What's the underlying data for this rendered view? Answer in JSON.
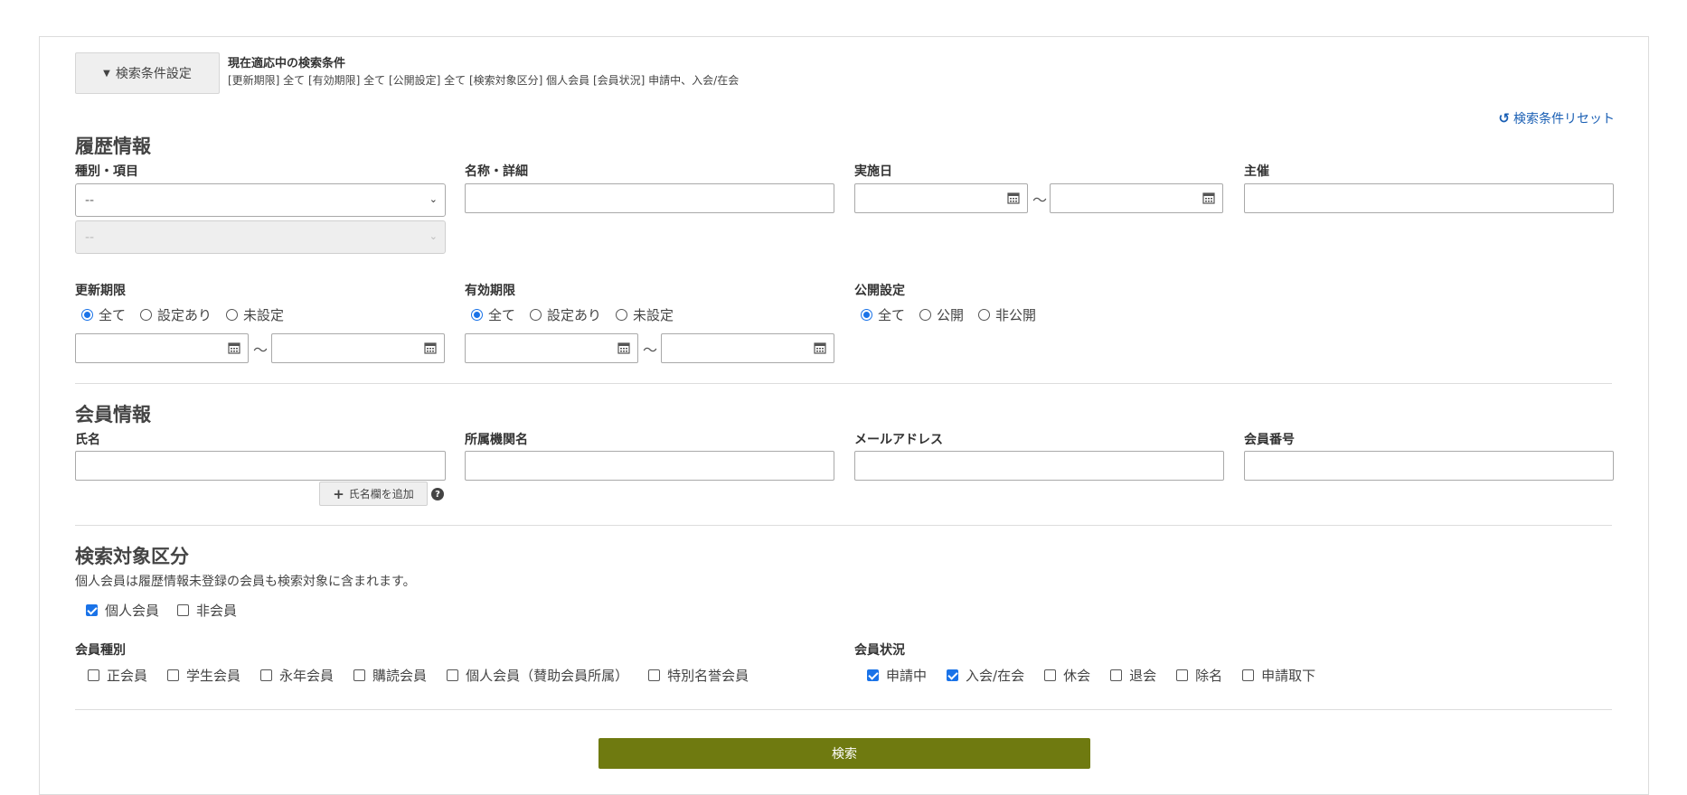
{
  "top": {
    "toggle_label": "検索条件設定",
    "current_title": "現在適応中の検索条件",
    "current_summary": "[更新期限] 全て [有効期限] 全て [公開設定] 全て [検索対象区分] 個人会員 [会員状況] 申請中、入会/在会",
    "reset_label": "検索条件リセット"
  },
  "history": {
    "title": "履歴情報",
    "type_label": "種別・項目",
    "type_select_value": "--",
    "type_sub_select_value": "--",
    "name_label": "名称・詳細",
    "date_label": "実施日",
    "date_sep": "～",
    "host_label": "主催",
    "update_label": "更新期限",
    "valid_label": "有効期限",
    "publish_label": "公開設定",
    "update_options": [
      "全て",
      "設定あり",
      "未設定"
    ],
    "valid_options": [
      "全て",
      "設定あり",
      "未設定"
    ],
    "publish_options": [
      "全て",
      "公開",
      "非公開"
    ],
    "range_sep": "～"
  },
  "member": {
    "title": "会員情報",
    "name_label": "氏名",
    "org_label": "所属機関名",
    "email_label": "メールアドレス",
    "number_label": "会員番号",
    "add_name_label": "氏名欄を追加"
  },
  "target": {
    "title": "検索対象区分",
    "note": "個人会員は履歴情報未登録の会員も検索対象に含まれます。",
    "options": [
      {
        "label": "個人会員",
        "checked": true
      },
      {
        "label": "非会員",
        "checked": false
      }
    ],
    "kind_label": "会員種別",
    "kinds": [
      "正会員",
      "学生会員",
      "永年会員",
      "購読会員",
      "個人会員（賛助会員所属）",
      "特別名誉会員"
    ],
    "status_label": "会員状況",
    "statuses": [
      {
        "label": "申請中",
        "checked": true
      },
      {
        "label": "入会/在会",
        "checked": true
      },
      {
        "label": "休会",
        "checked": false
      },
      {
        "label": "退会",
        "checked": false
      },
      {
        "label": "除名",
        "checked": false
      },
      {
        "label": "申請取下",
        "checked": false
      }
    ]
  },
  "search_label": "検索",
  "colors": {
    "accent": "#1a73e8",
    "search_button": "#6f7a10",
    "link": "#1a5fb4"
  }
}
